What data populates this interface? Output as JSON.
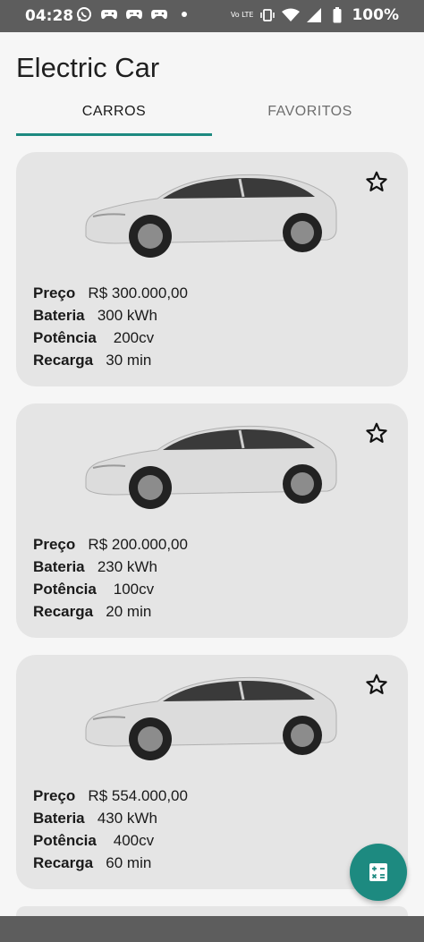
{
  "status_bar": {
    "time": "04:28",
    "left_icons": [
      "whatsapp-icon",
      "gamepad-icon",
      "gamepad-icon",
      "gamepad-icon",
      "dot-icon"
    ],
    "network_label": "Vo LTE",
    "battery": "100%"
  },
  "app": {
    "title": "Electric Car"
  },
  "tabs": [
    {
      "label": "CARROS",
      "active": true
    },
    {
      "label": "FAVORITOS",
      "active": false
    }
  ],
  "cars": [
    {
      "preco_label": "Preço",
      "preco": "R$ 300.000,00",
      "bateria_label": "Bateria",
      "bateria": "300 kWh",
      "potencia_label": "Potência",
      "potencia": "200cv",
      "recarga_label": "Recarga",
      "recarga": "30 min"
    },
    {
      "preco_label": "Preço",
      "preco": "R$ 200.000,00",
      "bateria_label": "Bateria",
      "bateria": "230 kWh",
      "potencia_label": "Potência",
      "potencia": "100cv",
      "recarga_label": "Recarga",
      "recarga": "20 min"
    },
    {
      "preco_label": "Preço",
      "preco": "R$ 554.000,00",
      "bateria_label": "Bateria",
      "bateria": "430 kWh",
      "potencia_label": "Potência",
      "potencia": "400cv",
      "recarga_label": "Recarga",
      "recarga": "60 min"
    }
  ],
  "fab": {
    "icon": "calculator-icon"
  },
  "colors": {
    "accent": "#1d8a80",
    "card_bg": "#e5e5e5",
    "bar_bg": "#5d5d5d"
  }
}
